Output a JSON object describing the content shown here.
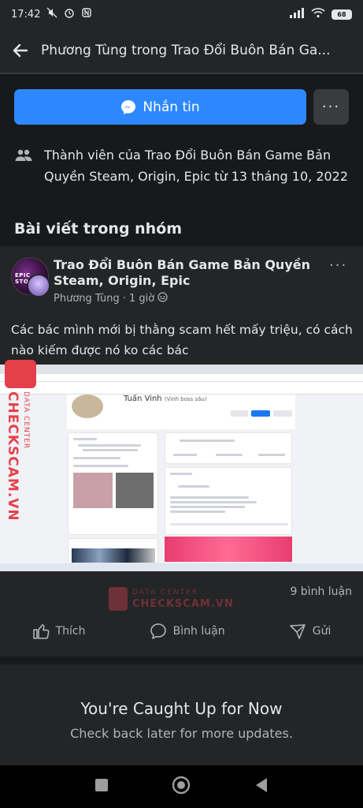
{
  "status_bar": {
    "time": "17:42",
    "battery": "68"
  },
  "header": {
    "title": "Phương Tùng trong Trao Đổi Buôn Bán Ga..."
  },
  "actions_top": {
    "message_label": "Nhắn tin",
    "more_label": "···"
  },
  "membership": {
    "text": "Thành viên của Trao Đổi Buôn Bán Game Bản Quyền Steam, Origin, Epic từ 13 tháng 10, 2022"
  },
  "section": {
    "title": "Bài viết trong nhóm"
  },
  "post": {
    "group_name": "Trao Đổi Buôn Bán Game Bản Quyền Steam, Origin, Epic",
    "author": "Phương Tùng",
    "time": "1 giờ",
    "meta_sep": "·",
    "body": "Các bác mình mới bị thằng scam hết mấy triệu, có cách nào kiếm được nó ko các bác",
    "screenshot_profile_name": "Tuấn Vinh",
    "screenshot_profile_nick": "(Vinh boss sầu)",
    "comments": "9 bình luận",
    "like_label": "Thích",
    "comment_label": "Bình luận",
    "send_label": "Gửi"
  },
  "watermark": {
    "brand": "CHECKSCAM.VN",
    "tag": "DATA CENTER"
  },
  "caught_up": {
    "title": "You're Caught Up for Now",
    "subtitle": "Check back later for more updates."
  },
  "colors": {
    "background": "#18191a",
    "surface": "#242526",
    "accent": "#2d88ff",
    "watermark": "#e4404c"
  }
}
